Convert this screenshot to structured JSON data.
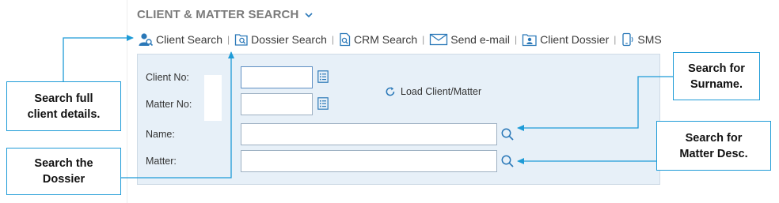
{
  "title": "CLIENT & MATTER SEARCH",
  "toolbar": {
    "client_search": "Client Search",
    "dossier_search": "Dossier Search",
    "crm_search": "CRM Search",
    "send_email": "Send e-mail",
    "client_dossier": "Client Dossier",
    "sms": "SMS",
    "separator": "|"
  },
  "form": {
    "client_no_label": "Client No:",
    "matter_no_label": "Matter No:",
    "name_label": "Name:",
    "matter_label": "Matter:",
    "client_no_value": "",
    "matter_no_value": "",
    "name_value": "",
    "matter_value": "",
    "load_label": "Load Client/Matter"
  },
  "callouts": {
    "full_client_line1": "Search full",
    "full_client_line2": "client details.",
    "dossier_line1": "Search the",
    "dossier_line2": "Dossier",
    "surname_line1": "Search for",
    "surname_line2": "Surname.",
    "matter_desc_line1": "Search for",
    "matter_desc_line2": "Matter Desc."
  },
  "colors": {
    "accent": "#1e9bd7",
    "panel_bg": "#e7f0f8",
    "icon_blue": "#2a78b8"
  }
}
